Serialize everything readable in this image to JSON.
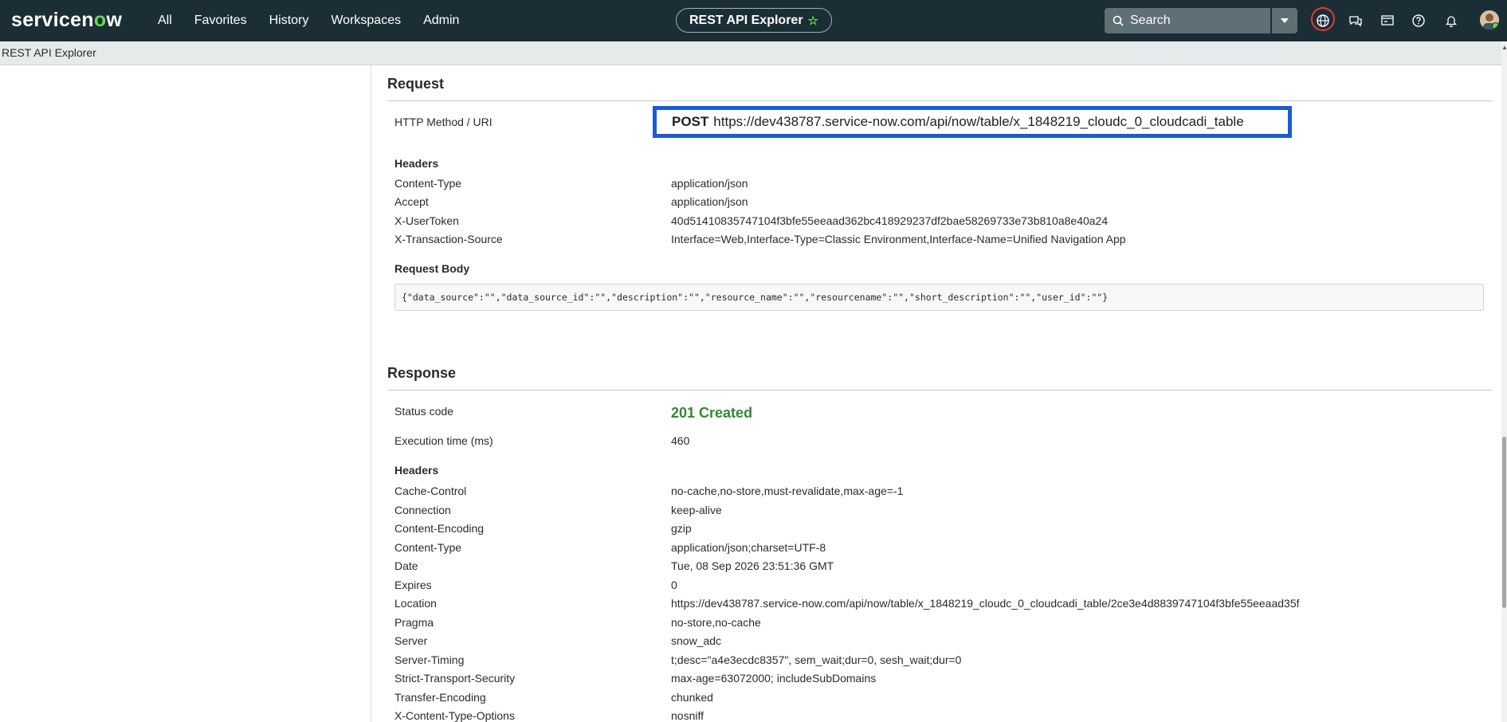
{
  "topnav": {
    "logo_text": "servicenow",
    "menu": [
      "All",
      "Favorites",
      "History",
      "Workspaces",
      "Admin"
    ],
    "app_pill": "REST API Explorer",
    "search_placeholder": "Search",
    "icons": [
      "globe-icon",
      "chat-icon",
      "card-icon",
      "help-icon",
      "bell-icon",
      "avatar"
    ]
  },
  "subbar": {
    "title": "REST API Explorer"
  },
  "request": {
    "title": "Request",
    "method_label": "HTTP Method / URI",
    "method": "POST",
    "uri": "https://dev438787.service-now.com/api/now/table/x_1848219_cloudc_0_cloudcadi_table",
    "headers_title": "Headers",
    "headers": [
      {
        "name": "Content-Type",
        "value": "application/json"
      },
      {
        "name": "Accept",
        "value": "application/json"
      },
      {
        "name": "X-UserToken",
        "value": "40d51410835747104f3bfe55eeaad362bc418929237df2bae58269733e73b810a8e40a24"
      },
      {
        "name": "X-Transaction-Source",
        "value": "Interface=Web,Interface-Type=Classic Environment,Interface-Name=Unified Navigation App"
      }
    ],
    "body_title": "Request Body",
    "body": "{\"data_source\":\"\",\"data_source_id\":\"\",\"description\":\"\",\"resource_name\":\"\",\"resourcename\":\"\",\"short_description\":\"\",\"user_id\":\"\"}"
  },
  "response": {
    "title": "Response",
    "status_label": "Status code",
    "status_value": "201 Created",
    "exec_label": "Execution time (ms)",
    "exec_value": "460",
    "headers_title": "Headers",
    "headers": [
      {
        "name": "Cache-Control",
        "value": "no-cache,no-store,must-revalidate,max-age=-1"
      },
      {
        "name": "Connection",
        "value": "keep-alive"
      },
      {
        "name": "Content-Encoding",
        "value": "gzip"
      },
      {
        "name": "Content-Type",
        "value": "application/json;charset=UTF-8"
      },
      {
        "name": "Date",
        "value": "Tue, 08 Sep 2026 23:51:36 GMT"
      },
      {
        "name": "Expires",
        "value": "0"
      },
      {
        "name": "Location",
        "value": "https://dev438787.service-now.com/api/now/table/x_1848219_cloudc_0_cloudcadi_table/2ce3e4d8839747104f3bfe55eeaad35f"
      },
      {
        "name": "Pragma",
        "value": "no-store,no-cache"
      },
      {
        "name": "Server",
        "value": "snow_adc"
      },
      {
        "name": "Server-Timing",
        "value": "t;desc=\"a4e3ecdc8357\", sem_wait;dur=0, sesh_wait;dur=0"
      },
      {
        "name": "Strict-Transport-Security",
        "value": "max-age=63072000; includeSubDomains"
      },
      {
        "name": "Transfer-Encoding",
        "value": "chunked"
      },
      {
        "name": "X-Content-Type-Options",
        "value": "nosniff"
      }
    ]
  }
}
